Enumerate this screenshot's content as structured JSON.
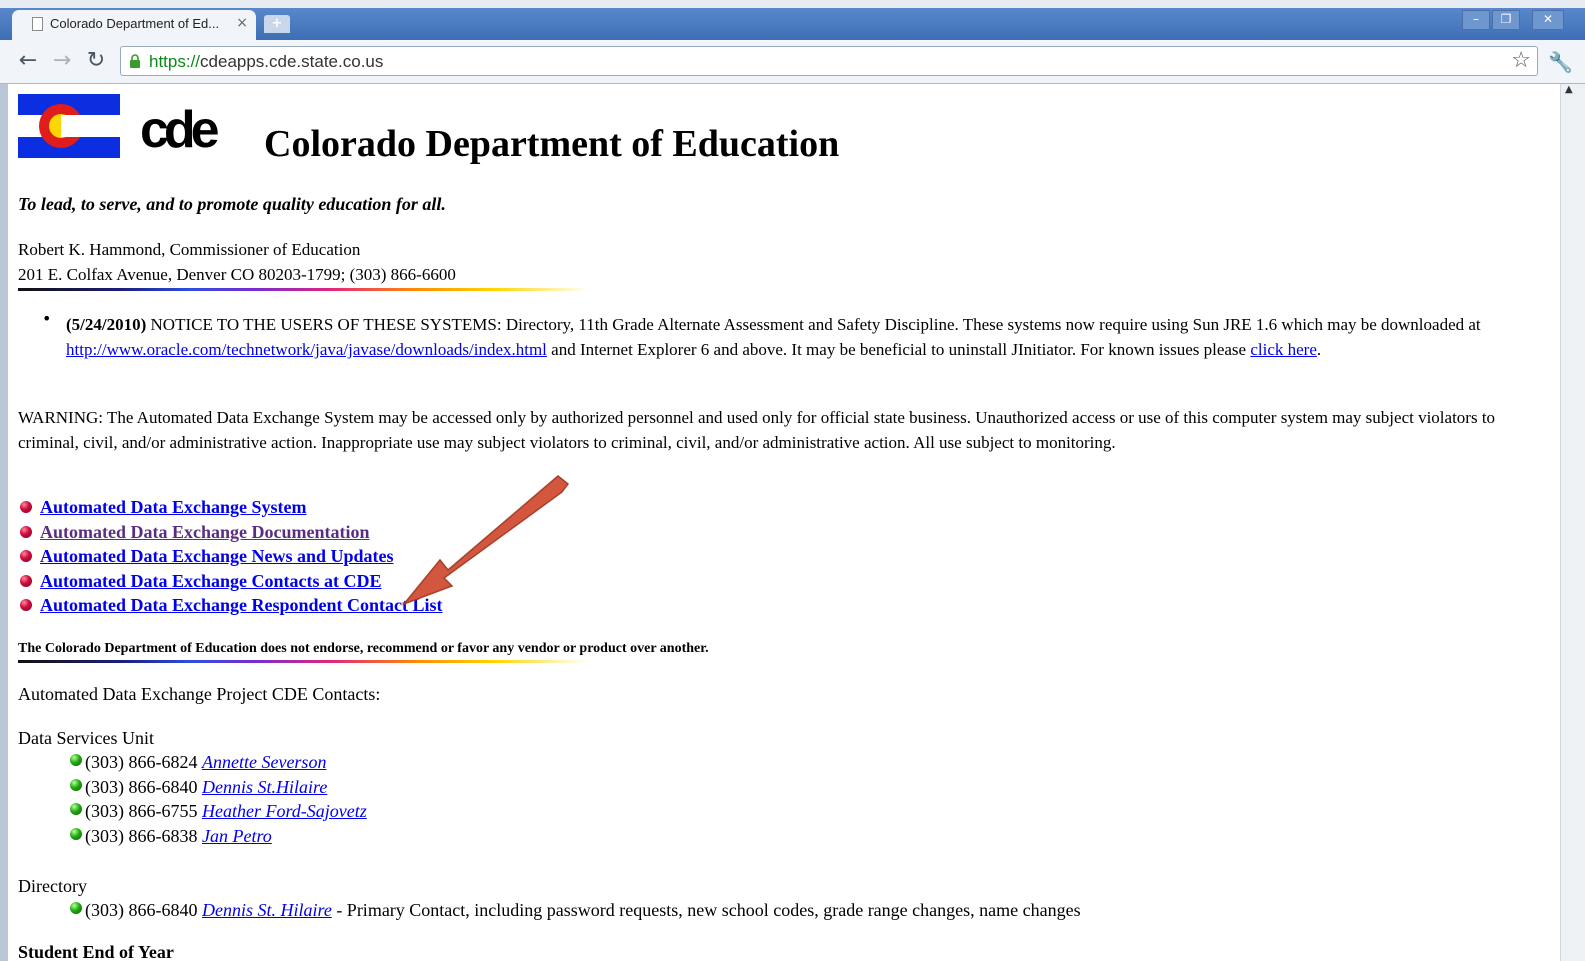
{
  "browser": {
    "tab_title": "Colorado Department of Ed...",
    "tab_close": "×",
    "new_tab": "+",
    "url_scheme": "https://",
    "url_host": "cdeapps.cde.state.co.us",
    "window_controls": {
      "minimize": "–",
      "restore": "❐",
      "close": "✕"
    },
    "nav": {
      "back": "←",
      "forward": "→",
      "reload": "↻"
    }
  },
  "header": {
    "logo_text": "cde",
    "title": "Colorado Department of Education",
    "motto": "To lead, to serve, and to promote quality education for all.",
    "commissioner": "Robert K. Hammond, Commissioner of Education",
    "address": "201 E. Colfax Avenue, Denver CO 80203-1799; (303) 866-6600"
  },
  "notice": {
    "date": "(5/24/2010)",
    "text1": " NOTICE TO THE USERS OF THESE SYSTEMS: Directory, 11th Grade Alternate Assessment and Safety Discipline. These systems now require using Sun JRE 1.6 which may be downloaded at ",
    "link": "http://www.oracle.com/technetwork/java/javase/downloads/index.html",
    "text2": " and Internet Explorer 6 and above. It may be beneficial to uninstall JInitiator. For known issues please ",
    "click_here": "click here",
    "text3": "."
  },
  "warning": "WARNING: The Automated Data Exchange System may be accessed only by authorized personnel and used only for official state business. Unauthorized access or use of this computer system may subject violators to criminal, civil, and/or administrative action. Inappropriate use may subject violators to criminal, civil, and/or administrative action. All use subject to monitoring.",
  "links": [
    "Automated Data Exchange System",
    "Automated Data Exchange Documentation",
    "Automated Data Exchange News and Updates",
    "Automated Data Exchange Contacts at CDE",
    "Automated Data Exchange Respondent Contact List"
  ],
  "disclaimer": "The Colorado Department of Education does not endorse, recommend or favor any vendor or product over another.",
  "contacts_title": "Automated Data Exchange Project CDE Contacts:",
  "data_services": {
    "heading": "Data Services Unit",
    "contacts": [
      {
        "phone": "(303) 866-6824",
        "name": "Annette Severson"
      },
      {
        "phone": "(303) 866-6840",
        "name": "Dennis St.Hilaire"
      },
      {
        "phone": "(303) 866-6755",
        "name": "Heather Ford-Sajovetz"
      },
      {
        "phone": "(303) 866-6838",
        "name": "Jan Petro"
      }
    ]
  },
  "directory": {
    "heading": "Directory",
    "contact": {
      "phone": "(303) 866-6840",
      "name": "Dennis St. Hilaire",
      "note": " - Primary Contact, including password requests, new school codes, grade range changes, name changes"
    }
  },
  "partial_heading": "Student End of Year",
  "colors": {
    "arrow": "#d2573e",
    "link": "#0000ee",
    "visited_link": "#5a2d82"
  }
}
